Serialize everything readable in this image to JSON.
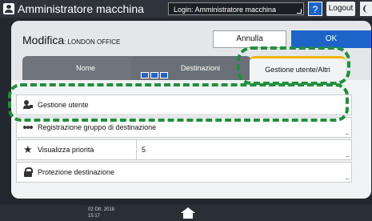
{
  "topbar": {
    "title": "Amministratore macchina",
    "login": "Login: Amministratore macchina",
    "help": "?",
    "logout": "Logout"
  },
  "dialog": {
    "title": "Modifica",
    "subtitle": ": LONDON OFFICE",
    "cancel": "Annulla",
    "ok": "OK",
    "tabs": [
      {
        "label": "Nome"
      },
      {
        "label": "Destinazioni"
      },
      {
        "label": "Gestione utente/Altri"
      }
    ]
  },
  "rows": [
    {
      "label": "Gestione utente",
      "icon": "user-lock-icon"
    },
    {
      "label": "Registrazione gruppo di destinazione",
      "icon": "group-icon"
    },
    {
      "label": "Visualizza priorità",
      "value": "5",
      "icon": "star-icon"
    },
    {
      "label": "Protezione destinazione",
      "icon": "lock-icon"
    }
  ],
  "bottombar": {
    "date": "02 Ott. 2018",
    "time": "15:17"
  },
  "colors": {
    "accent": "#1e64c8",
    "highlight": "#1f8f3c",
    "active_tab": "#f2b400"
  }
}
